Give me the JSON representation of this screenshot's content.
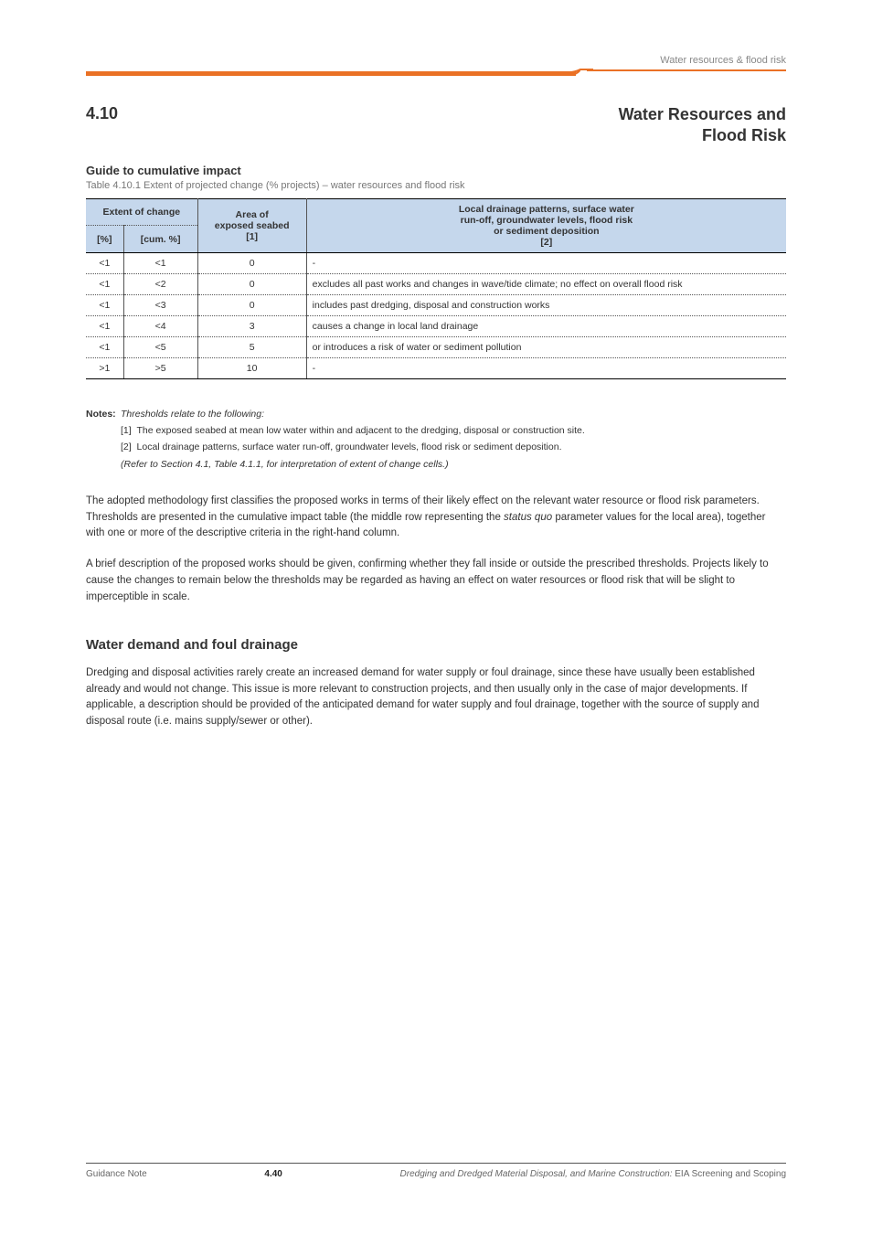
{
  "header_label": "Water resources & flood risk",
  "title_left": "4.10",
  "title_right": "Water Resources and\nFlood Risk",
  "subhead": "Guide to cumulative impact",
  "caption": "Table 4.10.1 Extent of projected change (% projects) – water resources and flood risk",
  "table": {
    "head": {
      "c1": "Extent of change",
      "c2": "Area of<br>exposed seabed<br>[1]",
      "c3": "Local drainage patterns, surface water<br>run-off, groundwater levels, flood risk<br>or sediment deposition<br>[2]"
    },
    "head2": {
      "pct": "[%]",
      "cum": "[cum. %]"
    },
    "rows": [
      {
        "pct": "<1",
        "cum": "<1",
        "c2": "0",
        "c3": "-"
      },
      {
        "pct": "<1",
        "cum": "<2",
        "c2": "0",
        "c3": "excludes all past works and changes in wave/tide climate; no effect on overall flood risk"
      },
      {
        "pct": "<1",
        "cum": "<3",
        "c2": "0",
        "c3": "includes past dredging, disposal and construction works"
      },
      {
        "pct": "<1",
        "cum": "<4",
        "c2": "3",
        "c3": "causes a change in local land drainage"
      },
      {
        "pct": "<1",
        "cum": "<5",
        "c2": "5",
        "c3": "or introduces a risk of water or sediment pollution"
      },
      {
        "pct": ">1",
        "cum": ">5",
        "c2": "10",
        "c3": "-"
      }
    ]
  },
  "notes": {
    "label": "Notes:",
    "intro": "Thresholds relate to the following:",
    "items": [
      "The exposed seabed at mean low water within and adjacent to the dredging, disposal or construction site.",
      "Local drainage patterns, surface water run-off, groundwater levels, flood risk or sediment deposition."
    ],
    "end": "(Refer to Section 4.1, Table 4.1.1, for interpretation of extent of change cells.)"
  },
  "para1_html": "The adopted methodology first classifies the proposed works in terms of their likely effect on the relevant water resource or flood risk parameters. Thresholds are presented in the cumulative impact table (the middle row representing the <span class=\"italic\">status quo</span> parameter values for the local area), together with one or more of the descriptive criteria in the right-hand column.",
  "para2": "A brief description of the proposed works should be given, confirming whether they fall inside or outside the prescribed thresholds. Projects likely to cause the changes to remain below the thresholds may be regarded as having an effect on water resources or flood risk that will be slight to imperceptible in scale.",
  "section_title": "Water demand and foul drainage",
  "para3": "Dredging and disposal activities rarely create an increased demand for water supply or foul drainage, since these have usually been established already and would not change. This issue is more relevant to construction projects, and then usually only in the case of major developments. If applicable, a description should be provided of the anticipated demand for water supply and foul drainage, together with the source of supply and disposal route (i.e. mains supply/sewer or other).",
  "footer": {
    "left": "Guidance Note",
    "page": "4.40",
    "right_html": "<span class=\"italic\">Dredging and Dredged Material Disposal, and Marine Construction:</span> EIA Screening and Scoping"
  }
}
